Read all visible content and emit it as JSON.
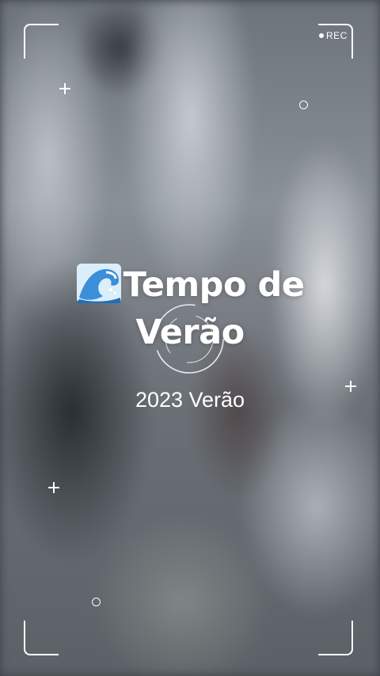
{
  "recording": {
    "label": "REC"
  },
  "title": {
    "icon": "water-wave-icon",
    "line1": "Tempo de",
    "line2": "Verão"
  },
  "subtitle": "2023 Verão",
  "colors": {
    "frame": "#ffffff",
    "text": "#ffffff",
    "wave": "#3b8fd9"
  }
}
